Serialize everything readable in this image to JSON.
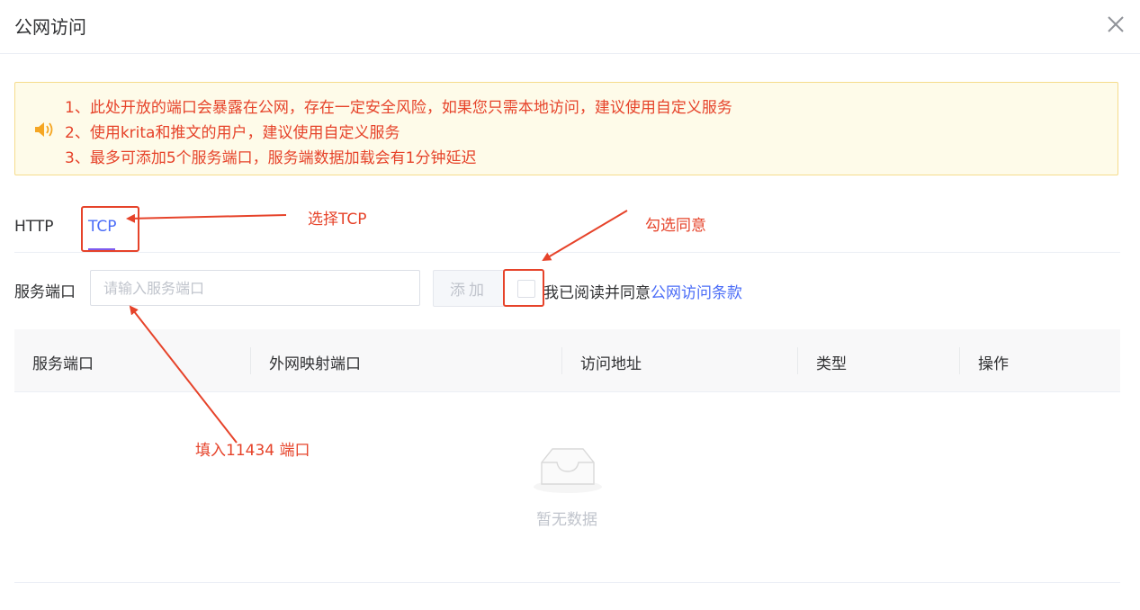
{
  "dialog": {
    "title": "公网访问",
    "close_icon": "close-icon"
  },
  "notice": {
    "icon": "speaker-icon",
    "lines": [
      "1、此处开放的端口会暴露在公网，存在一定安全风险，如果您只需本地访问，建议使用自定义服务",
      "2、使用krita和推文的用户，建议使用自定义服务",
      "3、最多可添加5个服务端口，服务端数据加载会有1分钟延迟"
    ]
  },
  "tabs": [
    {
      "label": "HTTP",
      "active": false
    },
    {
      "label": "TCP",
      "active": true
    }
  ],
  "form": {
    "label": "服务端口",
    "placeholder": "请输入服务端口",
    "value": "",
    "add_label": "添加",
    "agree_prefix": "我已阅读并同意",
    "agree_link": "公网访问条款"
  },
  "table": {
    "columns": [
      "服务端口",
      "外网映射端口",
      "访问地址",
      "类型",
      "操作"
    ],
    "empty_text": "暂无数据"
  },
  "annotations": {
    "select_tcp": "选择TCP",
    "check_agree": "勾选同意",
    "fill_port": "填入11434 端口"
  },
  "colors": {
    "annotation": "#e6432a",
    "accent": "#4a6cf7",
    "tab_underline": "#7e5bef",
    "notice_bg": "#fefbe9",
    "notice_border": "#f5dc8c"
  }
}
